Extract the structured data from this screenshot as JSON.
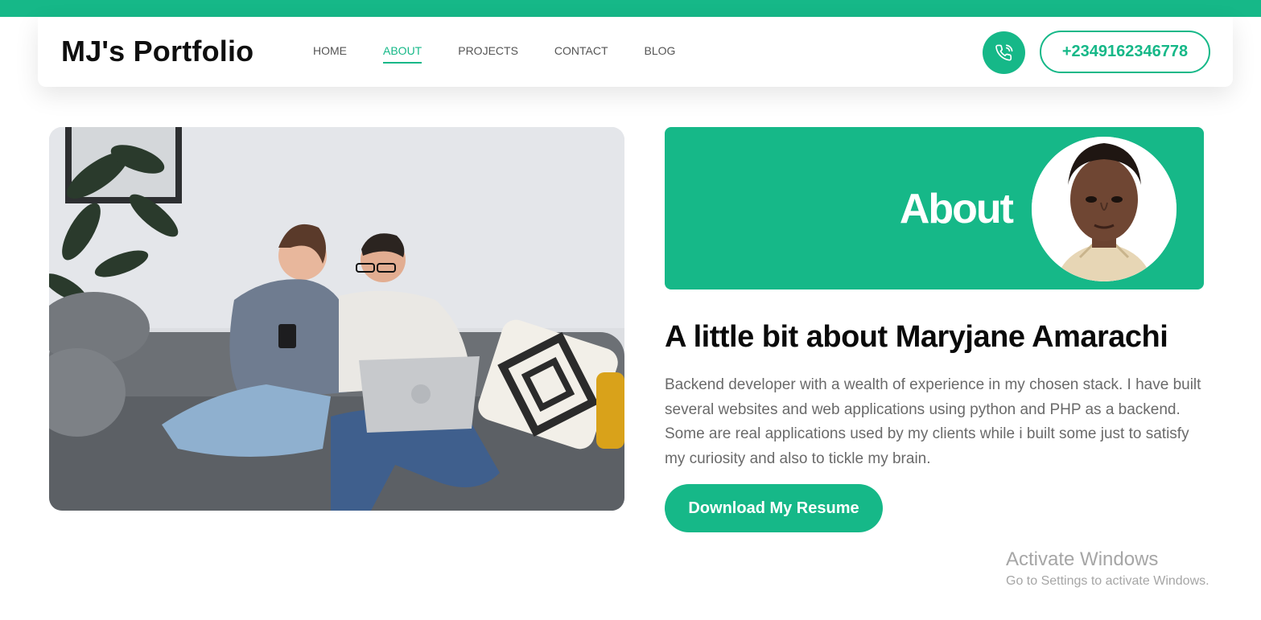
{
  "brand": {
    "name": "MJ's Portfolio"
  },
  "nav": {
    "items": [
      {
        "label": "HOME",
        "active": false
      },
      {
        "label": "ABOUT",
        "active": true
      },
      {
        "label": "PROJECTS",
        "active": false
      },
      {
        "label": "CONTACT",
        "active": false
      },
      {
        "label": "BLOG",
        "active": false
      }
    ]
  },
  "contact": {
    "phone_icon": "phone-call-icon",
    "phone_number": "+2349162346778"
  },
  "about": {
    "banner_title": "About",
    "headline": "A little bit about Maryjane Amarachi",
    "bio": "Backend developer with a wealth of experience in my chosen stack. I have built several websites and web applications using python and PHP as a backend. Some are real applications used by my clients while i built some just to satisfy my curiosity and also to tickle my brain.",
    "resume_button": "Download My Resume"
  },
  "system": {
    "activate_title": "Activate Windows",
    "activate_subtitle": "Go to Settings to activate Windows."
  },
  "colors": {
    "accent": "#16b888",
    "text_dark": "#0a0a0a",
    "text_muted": "#6a6a6a"
  }
}
